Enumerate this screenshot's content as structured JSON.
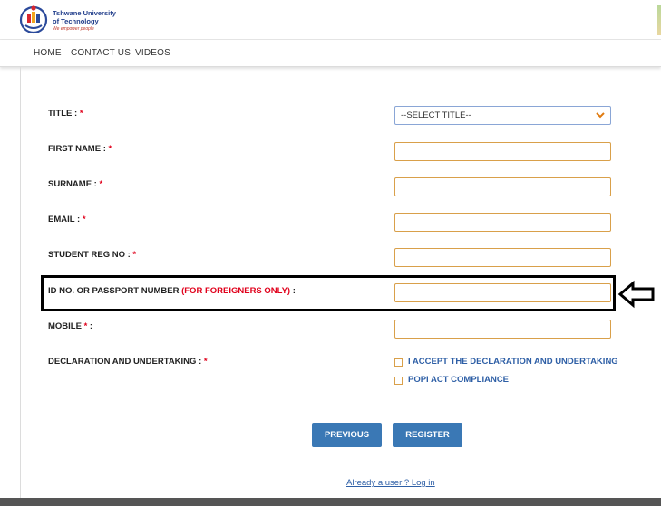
{
  "header": {
    "logo_name": "Tshwane University\nof Technology",
    "logo_tagline": "We empower people"
  },
  "nav": {
    "items": [
      "HOME",
      "CONTACT US",
      "VIDEOS"
    ]
  },
  "form": {
    "title_label": "TITLE : ",
    "title_select_value": "--SELECT TITLE--",
    "first_name_label": "FIRST NAME : ",
    "surname_label": "SURNAME : ",
    "email_label": "EMAIL : ",
    "student_reg_label": "STUDENT REG NO : ",
    "id_label": "ID NO. OR PASSPORT NUMBER ",
    "id_label_note": "(FOR FOREIGNERS ONLY)",
    "id_label_suffix": " :",
    "mobile_label": "MOBILE ",
    "mobile_label_suffix": " :",
    "declaration_label": "DECLARATION AND UNDERTAKING : ",
    "required_marker": "*",
    "accept_declaration": "I ACCEPT THE DECLARATION AND UNDERTAKING",
    "popi_compliance": "POPI ACT COMPLIANCE"
  },
  "buttons": {
    "previous": "PREVIOUS",
    "register": "REGISTER"
  },
  "footer": {
    "login_link": "Already a user ? Log in"
  },
  "colors": {
    "button_bg": "#3a78b5",
    "required_red": "#e0001b",
    "field_border": "#d9a04a",
    "link_blue": "#2e5fa6"
  },
  "icons": {
    "select_chevron": "chevron-down-icon",
    "pointer_arrow": "left-arrow-icon"
  }
}
